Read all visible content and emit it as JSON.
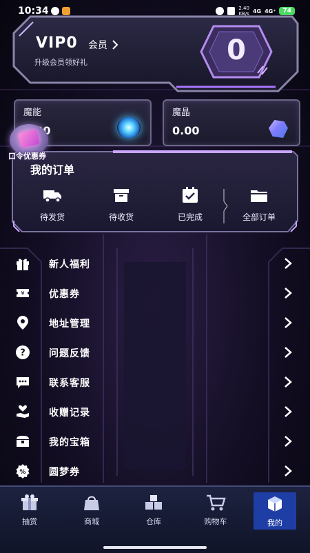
{
  "status_bar": {
    "time": "10:34",
    "net_speed_value": "2.40",
    "net_speed_unit": "KB/s",
    "signal_1": "4G",
    "signal_2": "4G⁺",
    "battery": "74"
  },
  "vip": {
    "title": "VIP0",
    "member_label": "会员",
    "subtitle": "升级会员领好礼",
    "level": "0"
  },
  "currency": {
    "mo_neng": {
      "label": "魔能",
      "value": "0.00"
    },
    "mo_jing": {
      "label": "魔晶",
      "value": "0.00"
    }
  },
  "coupon_badge": {
    "text": "口令优惠券"
  },
  "orders": {
    "title": "我的订单",
    "items": [
      {
        "label": "待发货",
        "icon": "truck-icon"
      },
      {
        "label": "待收货",
        "icon": "package-icon"
      },
      {
        "label": "已完成",
        "icon": "checkbox-icon"
      },
      {
        "label": "全部订单",
        "icon": "folder-icon"
      }
    ]
  },
  "menu": {
    "items": [
      {
        "label": "新人福利",
        "icon": "gift-icon"
      },
      {
        "label": "优惠券",
        "icon": "coupon-icon"
      },
      {
        "label": "地址管理",
        "icon": "location-icon"
      },
      {
        "label": "问题反馈",
        "icon": "question-icon"
      },
      {
        "label": "联系客服",
        "icon": "chat-icon"
      },
      {
        "label": "收赠记录",
        "icon": "heart-hand-icon"
      },
      {
        "label": "我的宝箱",
        "icon": "treasure-chest-icon"
      },
      {
        "label": "圆梦券",
        "icon": "percent-icon"
      }
    ]
  },
  "bottom_nav": {
    "items": [
      {
        "label": "抽赏",
        "icon": "gift-box-icon"
      },
      {
        "label": "商城",
        "icon": "shop-bag-icon"
      },
      {
        "label": "仓库",
        "icon": "warehouse-icon"
      },
      {
        "label": "购物车",
        "icon": "cart-icon"
      },
      {
        "label": "我的",
        "icon": "profile-cube-icon"
      }
    ],
    "active_index": 4
  },
  "colors": {
    "accent_purple": "#a977ff",
    "panel_border": "#6b6686",
    "nav_active": "#1e3ea6",
    "battery_green": "#4cd964"
  }
}
